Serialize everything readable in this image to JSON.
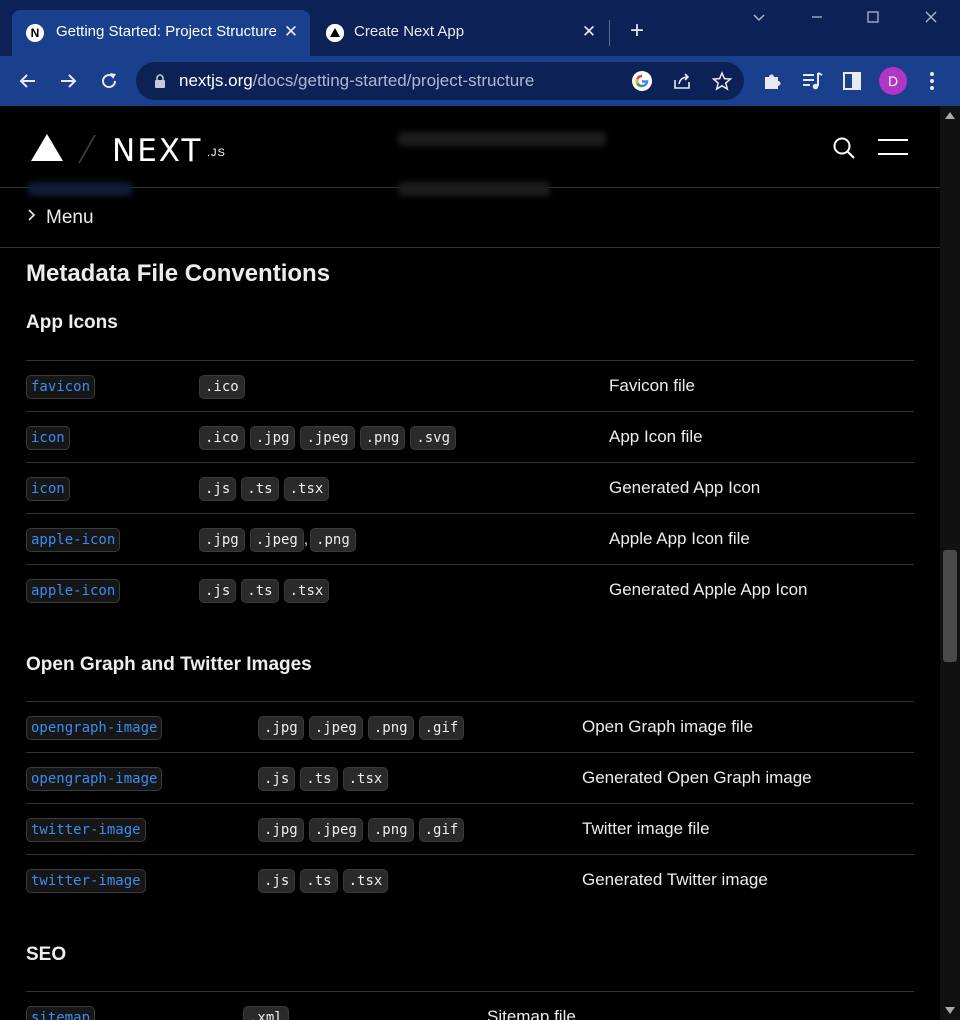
{
  "browser": {
    "tabs": [
      {
        "title": "Getting Started: Project Structure",
        "active": true
      },
      {
        "title": "Create Next App",
        "active": false
      }
    ],
    "url_host": "nextjs.org",
    "url_path": "/docs/getting-started/project-structure",
    "profile_initial": "D",
    "accent_color": "#1a3f8c"
  },
  "site": {
    "logo_text": "NEXT",
    "logo_suffix": ".JS",
    "menu_label": "Menu"
  },
  "content": {
    "title": "Metadata File Conventions",
    "app_icons": {
      "heading": "App Icons",
      "rows": [
        {
          "name": "favicon",
          "exts": [
            ".ico"
          ],
          "desc": "Favicon file"
        },
        {
          "name": "icon",
          "exts": [
            ".ico",
            ".jpg",
            ".jpeg",
            ".png",
            ".svg"
          ],
          "desc": "App Icon file"
        },
        {
          "name": "icon",
          "exts": [
            ".js",
            ".ts",
            ".tsx"
          ],
          "desc": "Generated App Icon"
        },
        {
          "name": "apple-icon",
          "exts": [
            ".jpg",
            ".jpeg",
            ".png"
          ],
          "desc": "Apple App Icon file"
        },
        {
          "name": "apple-icon",
          "exts": [
            ".js",
            ".ts",
            ".tsx"
          ],
          "desc": "Generated Apple App Icon"
        }
      ]
    },
    "og_twitter": {
      "heading": "Open Graph and Twitter Images",
      "rows": [
        {
          "name": "opengraph-image",
          "exts": [
            ".jpg",
            ".jpeg",
            ".png",
            ".gif"
          ],
          "desc": "Open Graph image file"
        },
        {
          "name": "opengraph-image",
          "exts": [
            ".js",
            ".ts",
            ".tsx"
          ],
          "desc": "Generated Open Graph image"
        },
        {
          "name": "twitter-image",
          "exts": [
            ".jpg",
            ".jpeg",
            ".png",
            ".gif"
          ],
          "desc": "Twitter image file"
        },
        {
          "name": "twitter-image",
          "exts": [
            ".js",
            ".ts",
            ".tsx"
          ],
          "desc": "Generated Twitter image"
        }
      ]
    },
    "seo": {
      "heading": "SEO",
      "rows": [
        {
          "name": "sitemap",
          "exts": [
            ".xml"
          ],
          "desc": "Sitemap file"
        }
      ]
    }
  }
}
